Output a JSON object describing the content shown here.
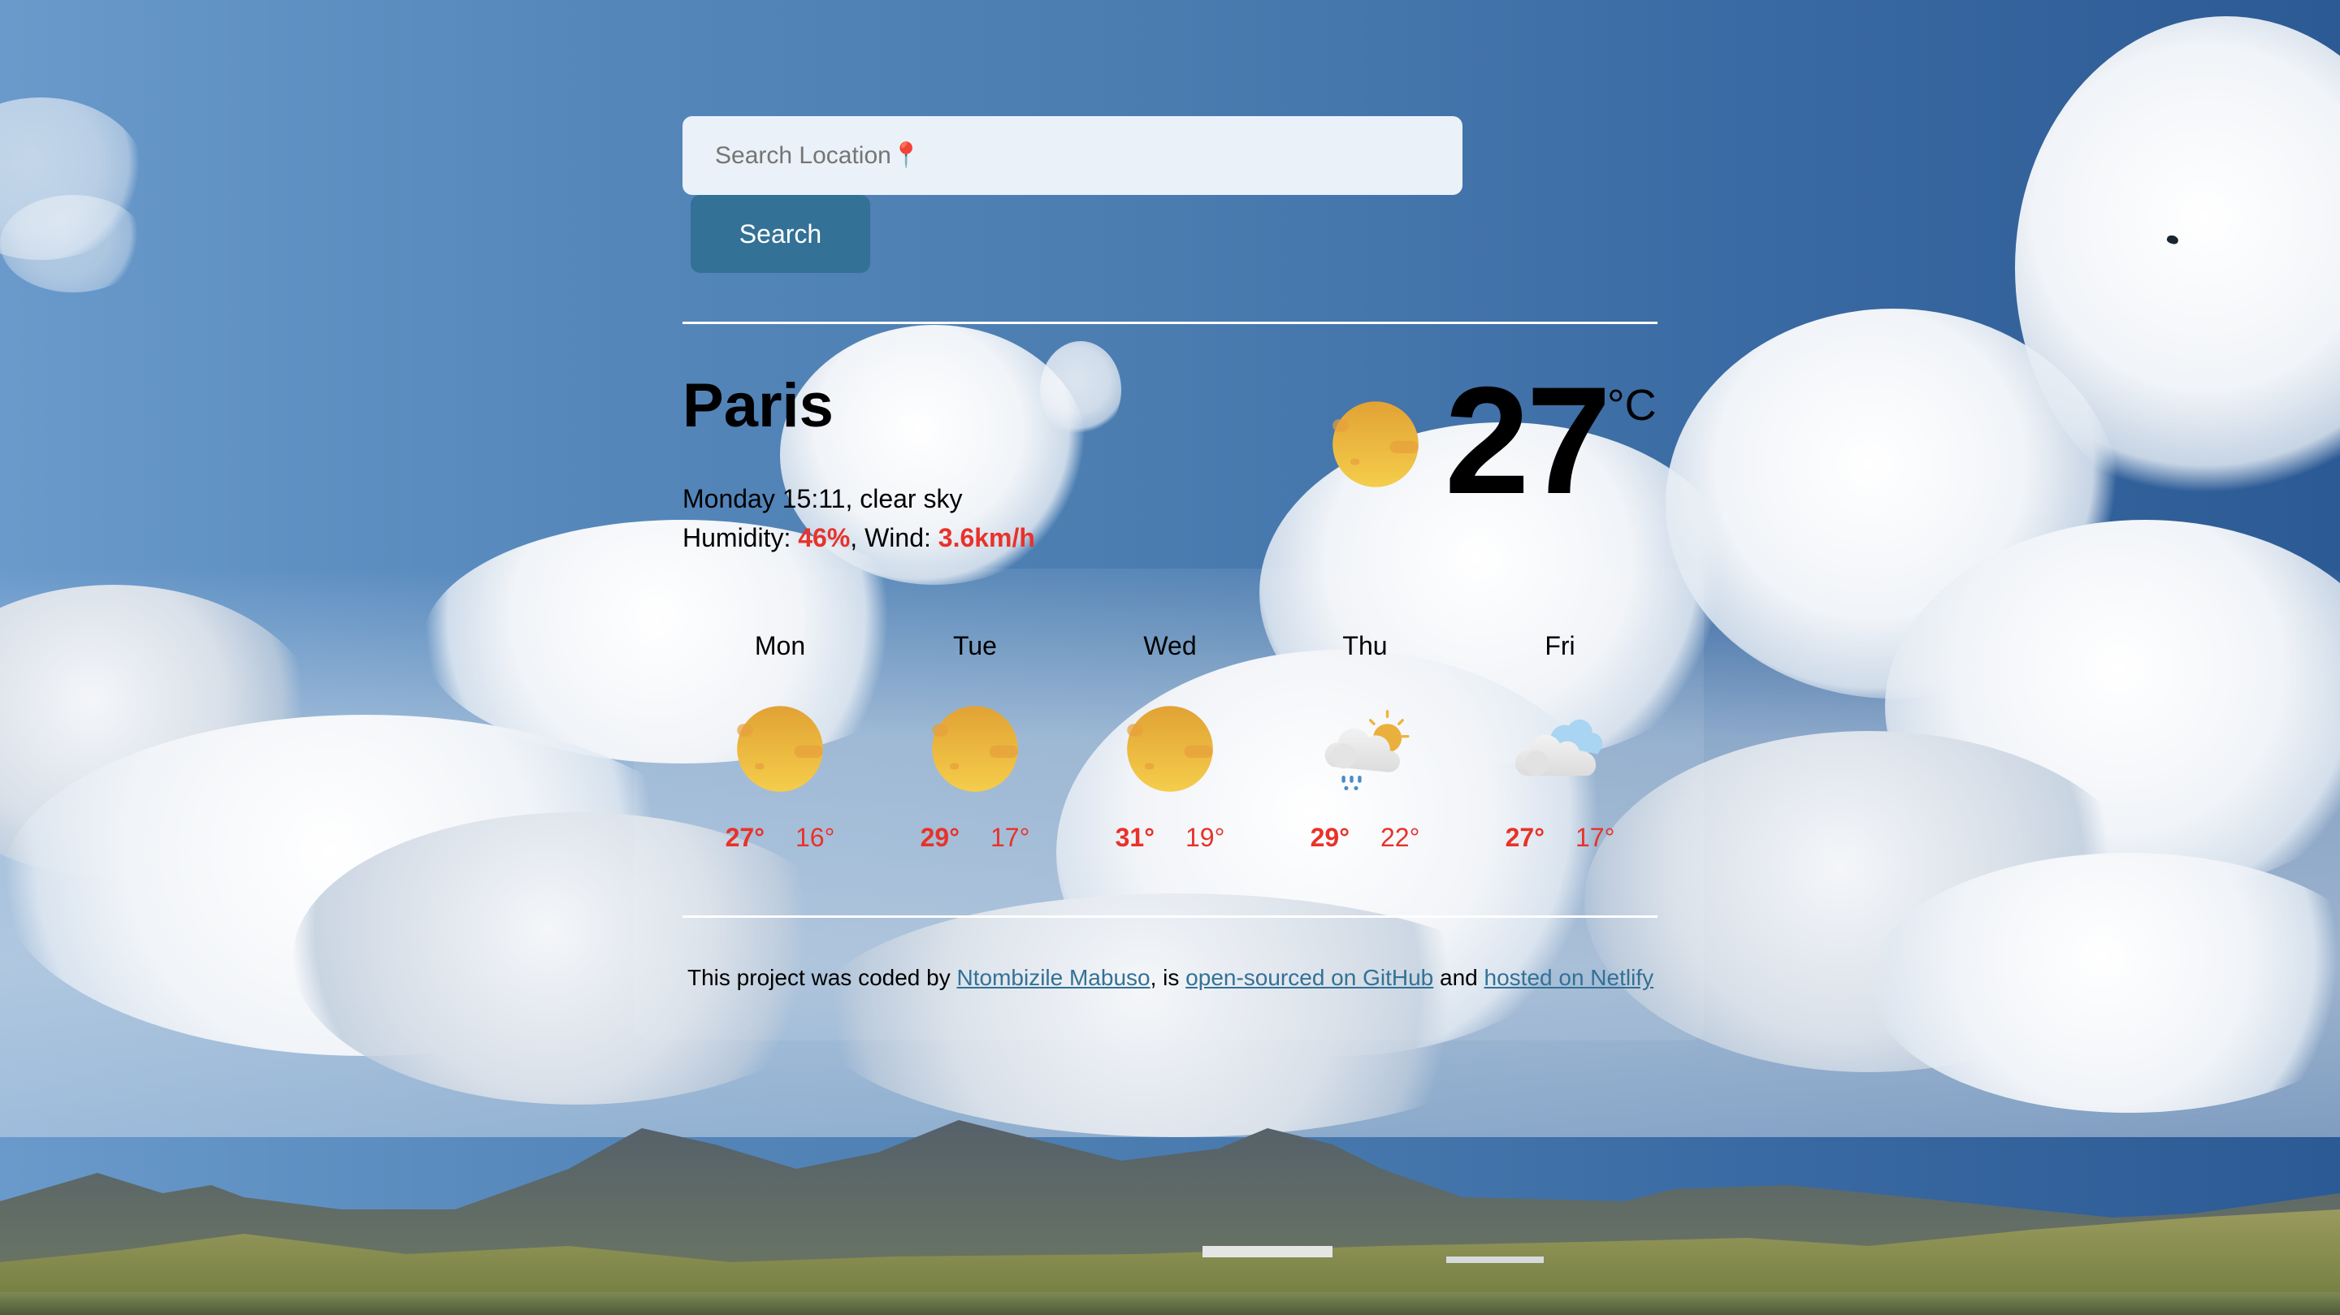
{
  "search": {
    "placeholder": "Search Location📍",
    "value": "",
    "button_label": "Search"
  },
  "current": {
    "city": "Paris",
    "datetime": "Monday 15:11",
    "description": "clear sky",
    "humidity_label": "Humidity:",
    "humidity": "46%",
    "wind_label": "Wind:",
    "wind": "3.6km/h",
    "temperature": "27",
    "unit": "°C",
    "icon": "sun-icon"
  },
  "forecast": [
    {
      "day": "Mon",
      "max": "27°",
      "min": "16°",
      "icon": "sun-icon"
    },
    {
      "day": "Tue",
      "max": "29°",
      "min": "17°",
      "icon": "sun-icon"
    },
    {
      "day": "Wed",
      "max": "31°",
      "min": "19°",
      "icon": "sun-icon"
    },
    {
      "day": "Thu",
      "max": "29°",
      "min": "22°",
      "icon": "sun-rain-cloud-icon"
    },
    {
      "day": "Fri",
      "max": "27°",
      "min": "17°",
      "icon": "cloudy-icon"
    }
  ],
  "footer": {
    "text_1": "This project was coded by ",
    "author_link": "Ntombizile Mabuso",
    "text_2": ", is ",
    "github_link": "open-sourced on GitHub",
    "text_3": " and ",
    "netlify_link": "hosted on Netlify"
  },
  "colors": {
    "accent_red": "#e8322a",
    "button": "#337196",
    "link": "#337196",
    "input_bg": "#eaf1f8"
  }
}
